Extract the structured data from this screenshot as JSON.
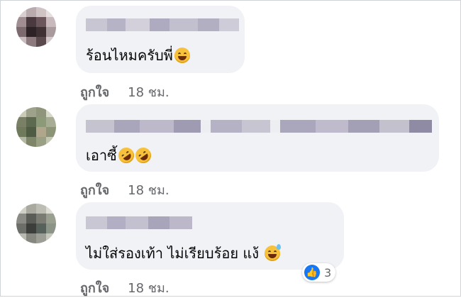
{
  "comments": [
    {
      "text": "ร้อนไหมครับพี่",
      "emoji_icons": [
        "grinning-squinting-face"
      ],
      "like_label": "ถูกใจ",
      "time": "18 ชม."
    },
    {
      "text": "เอาซี้",
      "emoji_icons": [
        "rolling-laughing-face",
        "rolling-laughing-face"
      ],
      "like_label": "ถูกใจ",
      "time": "18 ชม."
    },
    {
      "text": "ไม่ใส่รองเท้า ไม่เรียบร้อย แง้",
      "emoji_icons": [
        "grinning-sweat-face"
      ],
      "like_label": "ถูกใจ",
      "time": "18 ชม.",
      "reaction": {
        "icon": "like-icon",
        "count": "3"
      }
    }
  ],
  "colors": {
    "bubble": "#f0f2f5",
    "meta_text": "#65676b",
    "like_blue": "#1877f2"
  }
}
